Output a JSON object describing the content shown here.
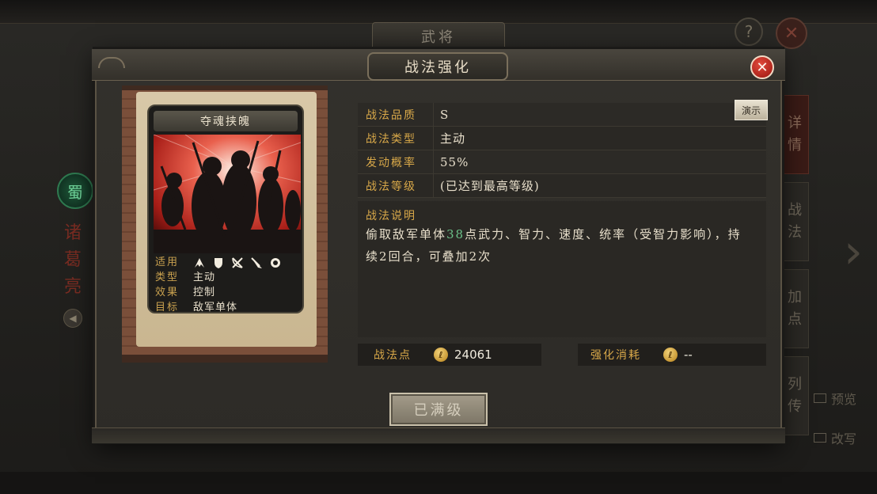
{
  "background": {
    "title": "武将",
    "help_symbol": "?",
    "close_symbol": "✕",
    "faction": "蜀",
    "general_name": [
      "诸",
      "葛",
      "亮"
    ],
    "tabs": [
      {
        "label": [
          "详",
          "情"
        ],
        "active": true
      },
      {
        "label": [
          "战",
          "法"
        ],
        "active": false
      },
      {
        "label": [
          "加",
          "点"
        ],
        "active": false
      },
      {
        "label": [
          "列",
          "传"
        ],
        "active": false
      }
    ],
    "right_buttons": [
      "预览",
      "改写"
    ]
  },
  "modal": {
    "title": "战法强化",
    "close_symbol": "✕",
    "simulate_button": "演示",
    "card": {
      "name": "夺魂挟魄",
      "stats": [
        {
          "key": "适用",
          "value": ""
        },
        {
          "key": "类型",
          "value": "主动"
        },
        {
          "key": "效果",
          "value": "控制"
        },
        {
          "key": "目标",
          "value": "敌军单体"
        }
      ],
      "troop_icons": [
        "cavalry-icon",
        "shield-icon",
        "bow-icon",
        "spear-icon",
        "siege-icon"
      ]
    },
    "info_rows": [
      {
        "key": "战法品质",
        "value": "S"
      },
      {
        "key": "战法类型",
        "value": "主动"
      },
      {
        "key": "发动概率",
        "value": "55%"
      },
      {
        "key": "战法等级",
        "value": "(已达到最高等级)"
      }
    ],
    "description": {
      "title": "战法说明",
      "text_before": "偷取敌军单体",
      "value1": "38",
      "text_middle": "点武力、智力、速度、统率（受智力影响），持续",
      "value2": "2",
      "text_mid2": "回合，可叠加",
      "value3": "2",
      "text_end": "次"
    },
    "points": {
      "label": "战法点",
      "value": "24061",
      "coin_symbol": "ℓ"
    },
    "cost": {
      "label": "强化消耗",
      "value": "--",
      "coin_symbol": "ℓ"
    },
    "max_level_button": "已满级"
  }
}
